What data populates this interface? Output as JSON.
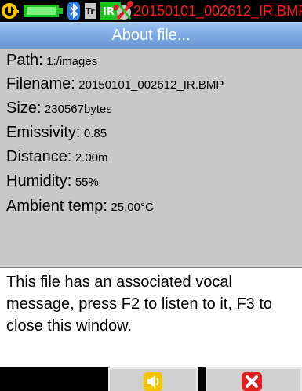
{
  "status_bar": {
    "filename": "20150101_002612_IR.BMP",
    "icons": [
      "thermometer-logo-icon",
      "battery-icon",
      "bluetooth-icon",
      "temperature-sensor-icon",
      "ir-image-icon",
      "camera-tools-icon"
    ]
  },
  "title": "About file...",
  "info": {
    "path_label": "Path:",
    "path_value": "1:/images",
    "filename_label": "Filename:",
    "filename_value": "20150101_002612_IR.BMP",
    "size_label": "Size:",
    "size_value": "230567bytes",
    "emissivity_label": "Emissivity:",
    "emissivity_value": "0.85",
    "distance_label": "Distance:",
    "distance_value": "2.00m",
    "humidity_label": "Humidity:",
    "humidity_value": "55%",
    "ambient_label": "Ambient temp:",
    "ambient_value": "25.00°C"
  },
  "message": "This file has an associated vocal message, press F2 to listen to it, F3 to close this window.",
  "softkeys": [
    {
      "icon": "speaker-icon",
      "color": "#f4c400"
    },
    {
      "icon": "close-icon",
      "color": "#e02020"
    }
  ]
}
